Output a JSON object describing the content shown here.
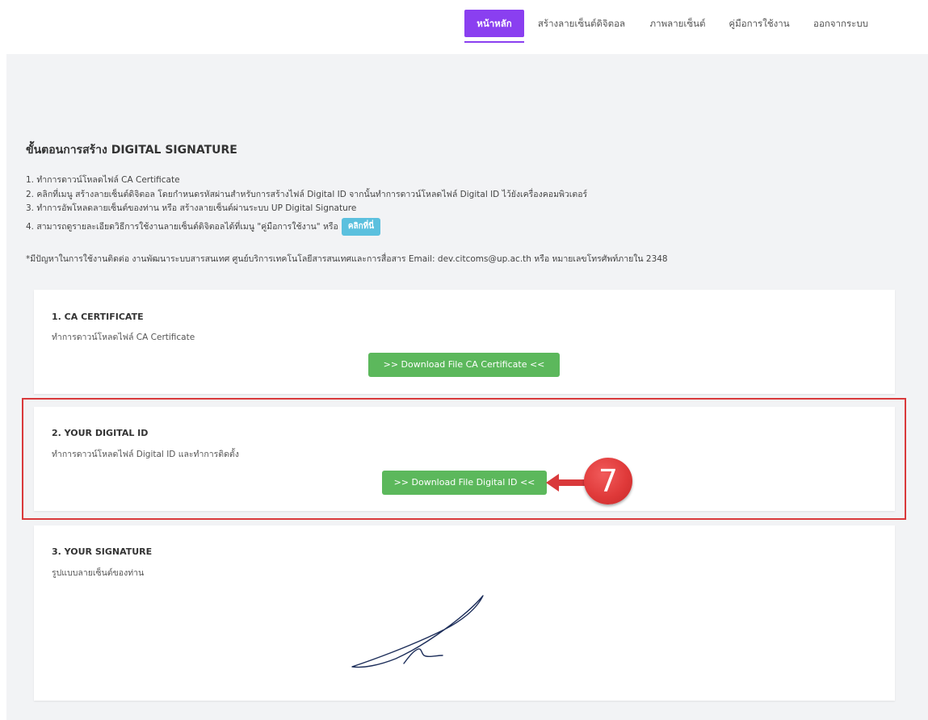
{
  "nav": {
    "items": [
      {
        "label": "หน้าหลัก",
        "active": true
      },
      {
        "label": "สร้างลายเซ็นต์ดิจิตอล",
        "active": false
      },
      {
        "label": "ภาพลายเซ็นต์",
        "active": false
      },
      {
        "label": "คู่มือการใช้งาน",
        "active": false
      },
      {
        "label": "ออกจากระบบ",
        "active": false
      }
    ],
    "accent_color": "#8a3ff0"
  },
  "page": {
    "title": "ขั้นตอนการสร้าง DIGITAL SIGNATURE",
    "steps": [
      "1. ทำการดาวน์โหลดไฟล์ CA Certificate",
      "2. คลิกที่เมนู สร้างลายเซ็นต์ดิจิตอล โดยกำหนดรหัสผ่านสำหรับการสร้างไฟล์ Digital ID จากนั้นทำการดาวน์โหลดไฟล์ Digital ID ไว้ยังเครื่องคอมพิวเตอร์",
      "3. ทำการอัพโหลดลายเซ็นต์ของท่าน หรือ สร้างลายเซ็นต์ผ่านระบบ UP Digital Signature",
      "4. สามารถดูรายละเอียดวิธีการใช้งานลายเซ็นต์ดิจิตอลได้ที่เมนู \"คู่มือการใช้งาน\" หรือ"
    ],
    "click_here_label": "คลิกที่นี่",
    "note": "*มีปัญหาในการใช้งานติดต่อ งานพัฒนาระบบสารสนเทศ ศูนย์บริการเทคโนโลยีสารสนเทศและการสื่อสาร Email: dev.citcoms@up.ac.th หรือ หมายเลขโทรศัพท์ภายใน 2348"
  },
  "cards": {
    "ca": {
      "title": "1. CA CERTIFICATE",
      "desc": "ทำการดาวน์โหลดไฟล์ CA Certificate",
      "button": ">> Download File CA Certificate <<"
    },
    "digital_id": {
      "title": "2. YOUR DIGITAL ID",
      "desc": "ทำการดาวน์โหลดไฟล์ Digital ID และทำการติดตั้ง",
      "button": ">> Download File Digital ID <<"
    },
    "signature": {
      "title": "3. YOUR SIGNATURE",
      "desc": "รูปแบบลายเซ็นต์ของท่าน"
    }
  },
  "annotation": {
    "step_number": "7",
    "highlight_color": "#d9393b"
  },
  "colors": {
    "button_green": "#5cb85c",
    "button_info": "#5bc0de",
    "background": "#f2f3f5"
  }
}
